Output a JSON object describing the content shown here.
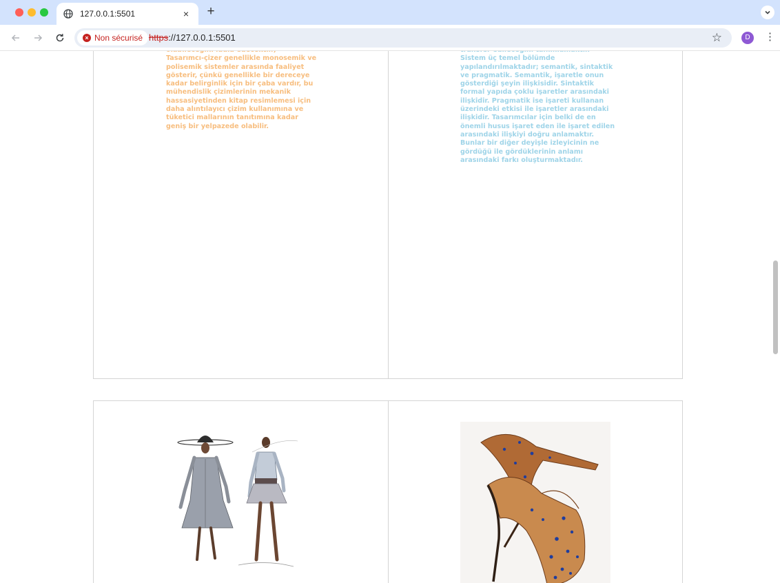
{
  "browser": {
    "tab": {
      "title": "127.0.0.1:5501",
      "close": "×"
    },
    "new_tab": "+",
    "address": {
      "security_label": "Non sécurisé",
      "url_scheme": "https",
      "url_rest": "://127.0.0.1:5501"
    },
    "avatar_letter": "D",
    "icons": {
      "back": "back-arrow-icon",
      "forward": "forward-arrow-icon",
      "reload": "reload-icon",
      "bookmark": "star-icon",
      "menu": "kebab-menu-icon"
    }
  },
  "content": {
    "left_text": [
      "olabileceğini iddia edecektir.)",
      "Tasarımcı-çizer genellikle monosemik ve",
      "polisemik sistemler arasında faaliyet",
      "gösterir, çünkü genellikle bir dereceye",
      "kadar belirginlik için bir çaba vardır, bu",
      "mühendislik çizimlerinin mekanik",
      "hassasiyetinden kitap resimlemesi için",
      "daha alıntılayıcı çizim kullanımına ve",
      "tüketici mallarının tanıtımına kadar",
      "geniş bir yelpazede olabilir."
    ],
    "right_text": [
      "transfer edileceğini tanımlamaktır.",
      "Sistem üç temel bölümde",
      "yapılandırılmaktadır; semantik, sintaktik",
      "ve pragmatik. Semantik, işaretle onun",
      "gösterdiği şeyin ilişkisidir. Sintaktik",
      "formal yapıda çoklu işaretler arasındaki",
      "ilişkidir. Pragmatik ise işareti kullanan",
      "üzerindeki etkisi ile işaretler arasındaki",
      "ilişkidir. Tasarımcılar için belki de en",
      "önemli husus işaret eden ile işaret edilen",
      "arasındaki ilişkiyi doğru anlamaktır.",
      "Bunlar bir diğer deyişle izleyicinin ne",
      "gördüğü ile gördüklerinin anlamı",
      "arasındaki farkı oluşturmaktadır."
    ],
    "colors": {
      "left_text": "#f7bd7e",
      "right_text": "#9fd4e8",
      "border": "#d4d4d4"
    },
    "images": [
      "fashion-sketch-two-models",
      "embellished-high-heel-shoes"
    ]
  }
}
